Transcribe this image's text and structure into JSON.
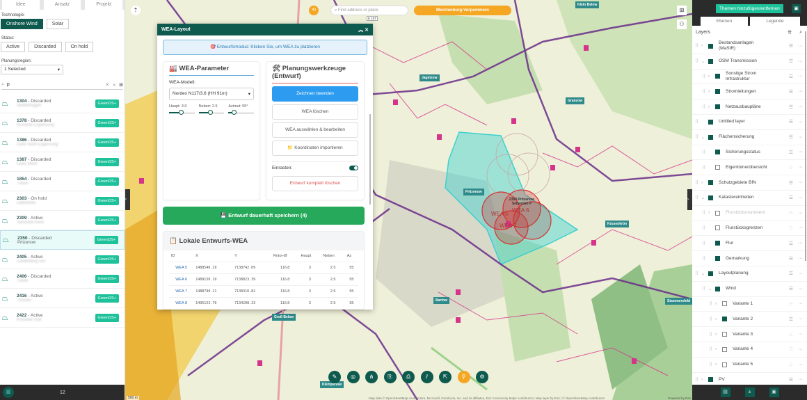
{
  "left": {
    "tabs": [
      "Idee",
      "Ansatz",
      "Projekt"
    ],
    "technologie_label": "Technologie:",
    "tech": [
      "Onshore Wind",
      "Solar"
    ],
    "status_label": "Status:",
    "status": [
      "Active",
      "Discarded",
      "On hold"
    ],
    "region_label": "Planungsregion:",
    "region_value": "1 Selected",
    "search_value": "p",
    "items": [
      {
        "id": "1304",
        "status": "Discarded",
        "sub": "Stoltenhagen"
      },
      {
        "id": "1378",
        "status": "Discarded",
        "sub": "Kruckow Ergänzung"
      },
      {
        "id": "1386",
        "status": "Discarded",
        "sub": "Gültz Nord Ergänzung"
      },
      {
        "id": "1387",
        "status": "Discarded",
        "sub": "Gültz West"
      },
      {
        "id": "1854",
        "status": "Discarded",
        "sub": "Tutow"
      },
      {
        "id": "2303",
        "status": "On hold",
        "sub": "Daberkow"
      },
      {
        "id": "2309",
        "status": "Active",
        "sub": "Sanzkow Nord"
      },
      {
        "id": "2350",
        "status": "Discarded",
        "sub": "Pritzenow",
        "selected": true
      },
      {
        "id": "2405",
        "status": "Active",
        "sub": "Lindenberg Ost"
      },
      {
        "id": "2406",
        "status": "Discarded",
        "sub": "Tutow"
      },
      {
        "id": "2416",
        "status": "Active",
        "sub": "Trissow"
      },
      {
        "id": "2422",
        "status": "Active",
        "sub": "Kruckow Süd"
      }
    ],
    "item_button": "GreenOS+",
    "count": "12"
  },
  "map": {
    "search_placeholder": "Find address or place",
    "region_button": "Mecklenburg-Vorpommern",
    "labels": [
      "Klein Below",
      "Jagetzow",
      "Granzow",
      "Pritzenow",
      "Krusenkrön",
      "Bartow",
      "Groß Below",
      "Stammersfeld",
      "Klempenow"
    ],
    "feature_label": "2350 Pritzenow Sebastian P",
    "wea_labels": [
      "WEA 5",
      "WEA 6",
      "WEA 7"
    ],
    "scale": "500 m",
    "attribution": "Map data © OpenStreetMap contributors, Microsoft, Facebook, Inc. and its affiliates, Esri Community Maps contributors, Map layer by Esri | © OpenStreetMap contributors",
    "powered": "Powered by Esri",
    "road": "K 107",
    "colors": {
      "accent": "#f5a623",
      "boundary": "#6a2c8a",
      "parcels": "#d6338a",
      "draft": "#3cd0d0",
      "wea": "#d83030"
    }
  },
  "dialog": {
    "title": "WEA-Layout",
    "info": "🎯 Entwurfsmodus: Klicken Sie, um WEA zu platzieren",
    "params_title": "WEA-Parameter",
    "model_label": "WEA-Modell:",
    "model_value": "Nordex N117/3.6 (HH 91m)",
    "sliders": [
      {
        "label": "Haupt: 3.0",
        "value": 3.0
      },
      {
        "label": "Neben: 2.5",
        "value": 2.5
      },
      {
        "label": "Azimut: 55°",
        "value": 55
      }
    ],
    "tools_title": "Planungswerkzeuge (Entwurf)",
    "tools": [
      "Zeichnen beenden",
      "WEA löschen",
      "WEA auswählen & bearbeiten",
      "📁 Koordinaten importieren"
    ],
    "snap_label": "Einrasten:",
    "snap_on": true,
    "delete_all": "Entwurf komplett löschen",
    "save": "💾 Entwurf dauerhaft speichern (4)",
    "table_title": "Lokale Entwurfs-WEA",
    "columns": [
      "ID",
      "X",
      "Y",
      "Rotor-Ø",
      "Haupt",
      "Neben",
      "Az"
    ],
    "rows": [
      [
        "WEA 5",
        "1488546.29",
        "7138742.09",
        "116.8",
        "3",
        "2.5",
        "55"
      ],
      [
        "WEA 6",
        "1489150.19",
        "7138823.39",
        "116.8",
        "3",
        "2.5",
        "55"
      ],
      [
        "WEA 7",
        "1488790.21",
        "7138310.82",
        "116.8",
        "3",
        "2.5",
        "55"
      ],
      [
        "WEA 8",
        "1495153.70",
        "7134208.33",
        "116.8",
        "3",
        "2.5",
        "55"
      ]
    ]
  },
  "right": {
    "add_themes": "Themen hinzufügen/entfernen",
    "tabs": [
      "Ebenen",
      "Legende"
    ],
    "layers_title": "Layers",
    "layers": [
      {
        "name": "Bestandsanlagen (MaStR)",
        "level": 0,
        "checked": true,
        "chev": ">"
      },
      {
        "name": "OSM Transmission",
        "level": 0,
        "checked": true,
        "chev": "v"
      },
      {
        "name": "Sonstige Strom Infrastruktur",
        "level": 1,
        "checked": true,
        "chev": ">"
      },
      {
        "name": "Stromleitungen",
        "level": 1,
        "checked": true,
        "chev": ">"
      },
      {
        "name": "Netzausbaupläne",
        "level": 1,
        "checked": true,
        "chev": ">"
      },
      {
        "name": "Untitled layer",
        "level": 0,
        "checked": true,
        "chev": ""
      },
      {
        "name": "Flächensicherung",
        "level": 0,
        "checked": true,
        "chev": "v"
      },
      {
        "name": "Sicherungsstatus",
        "level": 1,
        "checked": true,
        "chev": ""
      },
      {
        "name": "Eigentümerübersicht",
        "level": 1,
        "checked": false,
        "chev": ""
      },
      {
        "name": "Schutzgebiete BfN",
        "level": 0,
        "checked": true,
        "chev": ">"
      },
      {
        "name": "Katastereinheiten",
        "level": 0,
        "checked": true,
        "chev": "v"
      },
      {
        "name": "Flurstücksnummern",
        "level": 1,
        "checked": false,
        "chev": ">",
        "dim": true
      },
      {
        "name": "Flurstücksgrenzen",
        "level": 1,
        "checked": false,
        "chev": ""
      },
      {
        "name": "Flur",
        "level": 1,
        "checked": true,
        "chev": ""
      },
      {
        "name": "Gemarkung",
        "level": 1,
        "checked": true,
        "chev": ""
      },
      {
        "name": "Layoutplanung",
        "level": 0,
        "checked": true,
        "chev": "v"
      },
      {
        "name": "Wind",
        "level": 1,
        "checked": true,
        "chev": "v"
      },
      {
        "name": "Variante 1",
        "level": 2,
        "checked": false,
        "chev": ">"
      },
      {
        "name": "Variante 2",
        "level": 2,
        "checked": true,
        "chev": ">"
      },
      {
        "name": "Variante 3",
        "level": 2,
        "checked": false,
        "chev": ">"
      },
      {
        "name": "Variante 4",
        "level": 2,
        "checked": false,
        "chev": ">"
      },
      {
        "name": "Variante 5",
        "level": 2,
        "checked": false,
        "chev": ">"
      },
      {
        "name": "PV",
        "level": 0,
        "checked": true,
        "chev": ">"
      }
    ]
  }
}
